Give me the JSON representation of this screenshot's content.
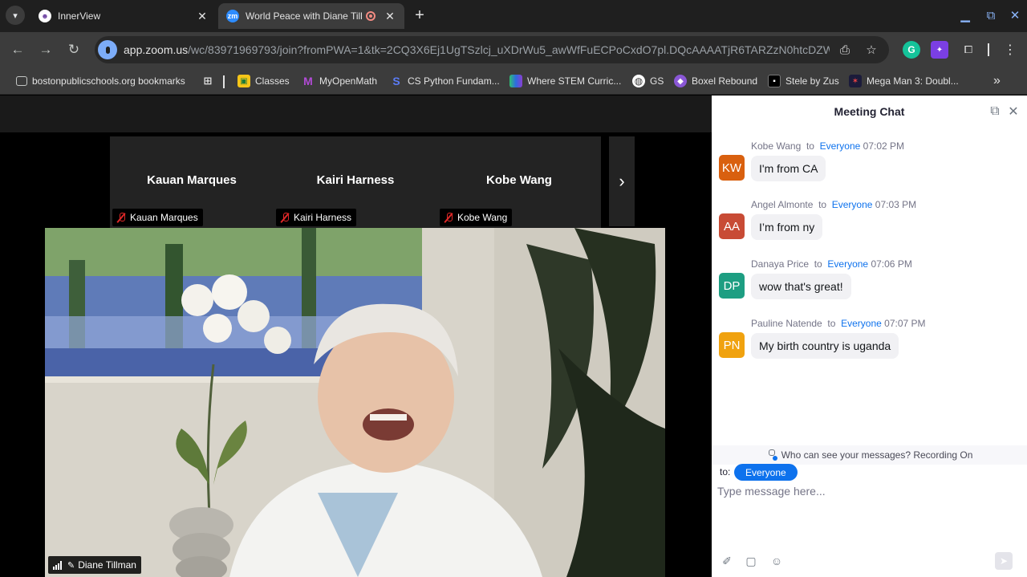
{
  "browser": {
    "tabs": [
      {
        "title": "InnerView",
        "active": false
      },
      {
        "title": "World Peace with Diane Till",
        "active": true
      }
    ],
    "url_host": "app.zoom.us",
    "url_path": "/wc/83971969793/join?fromPWA=1&tk=2CQ3X6Ej1UgTSzlcj_uXDrWu5_awWfFuECPoCxdO7pl.DQcAAAATjR6TARZzN0htcDZWV...",
    "bookmarks": [
      {
        "label": "bostonpublicschools.org bookmarks",
        "icon": "folder-icon"
      },
      {
        "label": "",
        "icon": "apps-grid-icon"
      },
      {
        "label": "Classes",
        "icon": "classes-icon"
      },
      {
        "label": "MyOpenMath",
        "icon": "myopenmath-icon"
      },
      {
        "label": "CS Python Fundam...",
        "icon": "python-icon"
      },
      {
        "label": "Where STEM Curric...",
        "icon": "stem-icon"
      },
      {
        "label": "GS",
        "icon": "globe-icon"
      },
      {
        "label": "Boxel Rebound",
        "icon": "boxel-icon"
      },
      {
        "label": "Stele by Zus",
        "icon": "stele-icon"
      },
      {
        "label": "Mega Man 3: Doubl...",
        "icon": "megaman-icon"
      }
    ],
    "colors": {
      "tabbar": "#1f1f1f",
      "toolbar": "#3c3c3c",
      "accent": "#8ab4f8"
    }
  },
  "meeting": {
    "participants": [
      {
        "name": "Kauan Marques",
        "tag": "Kauan Marques",
        "muted": true
      },
      {
        "name": "Kairi Harness",
        "tag": "Kairi Harness",
        "muted": true
      },
      {
        "name": "Kobe Wang",
        "tag": "Kobe Wang",
        "muted": true
      }
    ],
    "speaker": {
      "name": "Diane Tillman"
    }
  },
  "chat": {
    "title": "Meeting Chat",
    "messages": [
      {
        "sender": "Kobe Wang",
        "to_word": "to",
        "recipient": "Everyone",
        "time": "07:02 PM",
        "initials": "KW",
        "color": "#d9600f",
        "text": "I'm from CA"
      },
      {
        "sender": "Angel Almonte",
        "to_word": "to",
        "recipient": "Everyone",
        "time": "07:03 PM",
        "initials": "AA",
        "color": "#c84b35",
        "text": "I’m from ny"
      },
      {
        "sender": "Danaya Price",
        "to_word": "to",
        "recipient": "Everyone",
        "time": "07:06 PM",
        "initials": "DP",
        "color": "#1d9e82",
        "text": "wow that's great!"
      },
      {
        "sender": "Pauline Natende",
        "to_word": "to",
        "recipient": "Everyone",
        "time": "07:07 PM",
        "initials": "PN",
        "color": "#f0a20f",
        "text": "My birth country is uganda"
      }
    ],
    "notice": "Who can see your messages? Recording On",
    "to_label": "to:",
    "to_value": "Everyone",
    "input_placeholder": "Type message here..."
  }
}
